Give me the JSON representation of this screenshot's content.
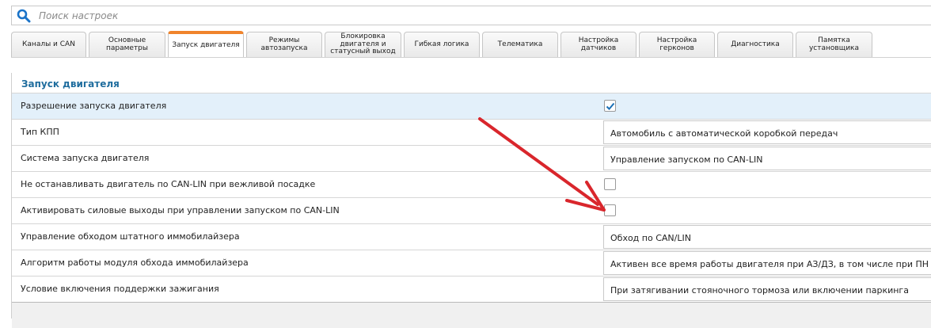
{
  "search": {
    "placeholder": "Поиск настроек"
  },
  "tabs": [
    {
      "label": "Каналы и CAN"
    },
    {
      "label": "Основные параметры"
    },
    {
      "label": "Запуск двигателя"
    },
    {
      "label": "Режимы автозапуска"
    },
    {
      "label": "Блокировка двигателя и статусный выход"
    },
    {
      "label": "Гибкая логика"
    },
    {
      "label": "Телематика"
    },
    {
      "label": "Настройка датчиков"
    },
    {
      "label": "Настройка герконов"
    },
    {
      "label": "Диагностика"
    },
    {
      "label": "Памятка установщика"
    }
  ],
  "active_tab": "Запуск двигателя",
  "section": {
    "title": "Запуск двигателя"
  },
  "rows": [
    {
      "label": "Разрешение запуска двигателя",
      "type": "checkbox",
      "checked": true
    },
    {
      "label": "Тип КПП",
      "type": "select",
      "value": "Автомобиль с автоматической коробкой передач"
    },
    {
      "label": "Система запуска двигателя",
      "type": "select",
      "value": "Управление запуском по CAN-LIN"
    },
    {
      "label": "Не останавливать двигатель по CAN-LIN при вежливой посадке",
      "type": "checkbox",
      "checked": false
    },
    {
      "label": "Активировать силовые выходы при управлении запуском по CAN-LIN",
      "type": "checkbox",
      "checked": false
    },
    {
      "label": "Управление обходом штатного иммобилайзера",
      "type": "select",
      "value": "Обход по CAN/LIN"
    },
    {
      "label": "Алгоритм работы модуля обхода иммобилайзера",
      "type": "select",
      "value": "Активен все время работы двигателя при АЗ/ДЗ, в том числе при ПН и ТТ"
    },
    {
      "label": "Условие включения поддержки зажигания",
      "type": "select",
      "value": "При затягивании стояночного тормоза или включении паркинга"
    }
  ],
  "colors": {
    "accent": "#1f6d9e",
    "active_tab": "#f0842c",
    "annotation_arrow": "#d9262c",
    "highlight_row": "#e3f0fa"
  },
  "icons": {
    "search": "search-icon",
    "check": "check-icon",
    "arrow": "red-arrow-annotation"
  }
}
